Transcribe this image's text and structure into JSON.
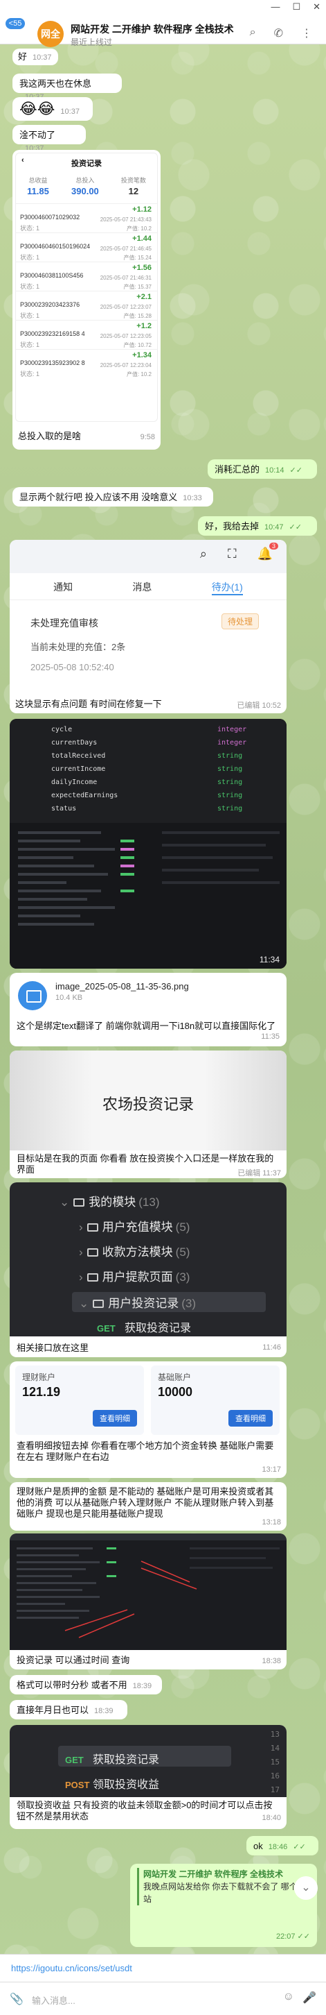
{
  "header": {
    "back_badge": "55",
    "avatar_text": "网全",
    "title": "网站开发 二开维护 软件程序 全栈技术",
    "status": "最近上线过"
  },
  "messages": {
    "m1": {
      "text": "好",
      "time": "10:37"
    },
    "m2": {
      "text": "我这两天也在休息",
      "time": "10:37"
    },
    "m3": {
      "text": "😂😂",
      "time": "10:37"
    },
    "m4": {
      "text": "淦不动了",
      "time": "10:37"
    },
    "m5": {
      "text": "总投入取的是啥",
      "time": "9:58"
    },
    "m6": {
      "text": "消耗汇总的",
      "time": "10:14"
    },
    "m7": {
      "text": "显示两个就行吧 投入应该不用 没啥意义",
      "time": "10:33"
    },
    "m8": {
      "text": "好，我给去掉",
      "time": "10:47"
    },
    "m9": {
      "text": "这块显示有点问题 有时间在修复一下",
      "time": "已编辑 10:52"
    },
    "m10": {
      "time": "11:34"
    },
    "m11": {
      "filename": "image_2025-05-08_11-35-36.png",
      "size": "10.4 KB",
      "text": "这个是绑定text翻译了 前端你就调用一下i18n就可以直接国际化了",
      "time": "11:35"
    },
    "m12": {
      "text": "目标站是在我的页面 你看看 放在投资挨个入口还是一样放在我的界面",
      "time": "已编辑 11:37"
    },
    "m13": {
      "text": "相关接口放在这里",
      "time": "11:46"
    },
    "m14": {
      "text": "查看明细按钮去掉 你看看在哪个地方加个资金转换 基础账户需要在左右 理财账户在右边",
      "time": "13:17"
    },
    "m15": {
      "text": "理财账户是质押的金额 是不能动的 基础账户是可用来投资或者其他的消费 可以从基础账户转入理财账户 不能从理财账户转入到基础账户 提现也是只能用基础账户提现",
      "time": "13:18"
    },
    "m16": {
      "text": "投资记录 可以通过时间 查询",
      "time": "18:38"
    },
    "m17": {
      "text": "格式可以带时分秒 或者不用",
      "time": "18:39"
    },
    "m18": {
      "text": "直接年月日也可以",
      "time": "18:39"
    },
    "m19": {
      "text": "领取投资收益 只有投资的收益未领取金额>0的时间才可以点击按钮不然是禁用状态",
      "time": "18:40"
    },
    "m20": {
      "text": "ok",
      "time": "18:46"
    },
    "m21": {
      "quote_title": "网站开发 二开维护 软件程序 全栈技术",
      "quote_text": "我晚点网站发给你 你去下载就不会了 哪个网站",
      "time": "22:07"
    }
  },
  "invest_card": {
    "title": "投资记录",
    "stats": [
      {
        "label": "总收益",
        "value": "11.85"
      },
      {
        "label": "总投入",
        "value": "390.00"
      },
      {
        "label": "投资笔数",
        "value": "12"
      }
    ],
    "rows": [
      {
        "id": "P3000460071029032",
        "status": "状态: 1",
        "amount": "+1.12",
        "date": "2025-05-07 21:43:43",
        "price": "产值: 10.2"
      },
      {
        "id": "P3000460460150196024",
        "status": "状态: 1",
        "amount": "+1.44",
        "date": "2025-05-07 21:46:45",
        "price": "产值: 15.24"
      },
      {
        "id": "P3000460381100S456",
        "status": "状态: 1",
        "amount": "+1.56",
        "date": "2025-05-07 21:46:31",
        "price": "产值: 15.37"
      },
      {
        "id": "P3000239203423376",
        "status": "状态: 1",
        "amount": "+2.1",
        "date": "2025-05-07 12:23:07",
        "price": "产值: 15.28"
      },
      {
        "id": "P3000239232169158 4",
        "status": "状态: 1",
        "amount": "+1.2",
        "date": "2025-05-07 12:23:05",
        "price": "产值: 10.72"
      },
      {
        "id": "P3000239135923902 8",
        "status": "状态: 1",
        "amount": "+1.34",
        "date": "2025-05-07 12:23:04",
        "price": "产值: 10.2"
      }
    ]
  },
  "notif_card": {
    "bell_count": "3",
    "tabs": [
      "通知",
      "消息",
      "待办(1)"
    ],
    "title": "未处理充值审核",
    "badge": "待处理",
    "detail": "当前未处理的充值：2条",
    "date": "2025-05-08 10:52:40"
  },
  "code_card": {
    "fields": [
      {
        "name": "cycle",
        "type": "integer"
      },
      {
        "name": "currentDays",
        "type": "integer"
      },
      {
        "name": "totalReceived",
        "type": "string"
      },
      {
        "name": "currentIncome",
        "type": "string"
      },
      {
        "name": "dailyIncome",
        "type": "string"
      },
      {
        "name": "expectedEarnings",
        "type": "string"
      },
      {
        "name": "status",
        "type": "string"
      }
    ]
  },
  "farm_card": {
    "title": "农场投资记录"
  },
  "tree": {
    "items": [
      {
        "label": "我的模块",
        "count": "(13)"
      },
      {
        "label": "用户充值模块",
        "count": "(5)"
      },
      {
        "label": "收款方法模块",
        "count": "(5)"
      },
      {
        "label": "用户提款页面",
        "count": "(3)"
      },
      {
        "label": "用户投资记录",
        "count": "(3)"
      }
    ],
    "method": "GET",
    "endpoint": "获取投资记录"
  },
  "accounts": {
    "left_label": "理财账户",
    "left_value": "121.19",
    "left_btn": "查看明细",
    "right_label": "基础账户",
    "right_value": "10000",
    "right_btn": "查看明细"
  },
  "api_card": {
    "lines": [
      "13",
      "14",
      "15",
      "16",
      "17"
    ],
    "get_label": "GET",
    "get_text": "获取投资记录",
    "post_label": "POST",
    "post_text": "领取投资收益"
  },
  "pinned": {
    "url": "https://igoutu.cn/icons/set/usdt"
  },
  "input": {
    "placeholder": "输入消息..."
  },
  "colors": {
    "accent": "#3a8ee6",
    "out_bubble": "#e2ffc7",
    "bg": "#b9cf9a"
  }
}
